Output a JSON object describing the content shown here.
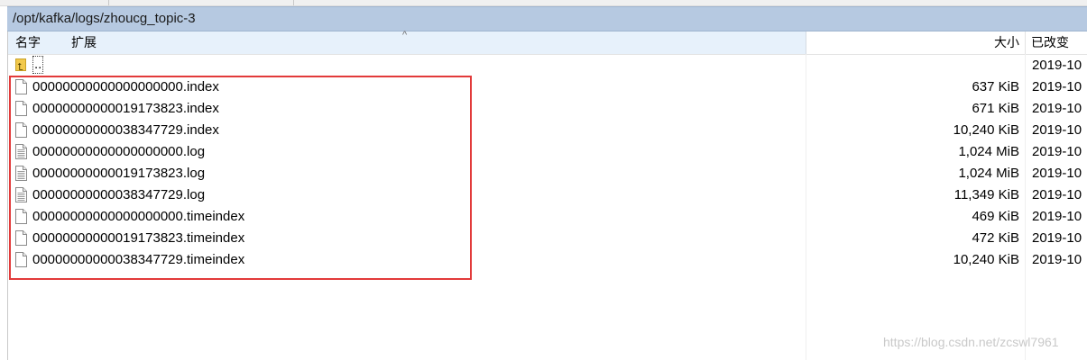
{
  "window": {
    "path": "/opt/kafka/logs/zhoucg_topic-3"
  },
  "columns": {
    "name": "名字",
    "ext": "扩展",
    "sort_indicator": "^",
    "size": "大小",
    "changed": "已改变"
  },
  "parent_entry": {
    "name": "..",
    "date": "2019-10"
  },
  "files": [
    {
      "name": "00000000000000000000.index",
      "size": "637 KiB",
      "date": "2019-10",
      "icon": "blank-file-icon"
    },
    {
      "name": "00000000000019173823.index",
      "size": "671 KiB",
      "date": "2019-10",
      "icon": "blank-file-icon"
    },
    {
      "name": "00000000000038347729.index",
      "size": "10,240 KiB",
      "date": "2019-10",
      "icon": "blank-file-icon"
    },
    {
      "name": "00000000000000000000.log",
      "size": "1,024 MiB",
      "date": "2019-10",
      "icon": "text-file-icon"
    },
    {
      "name": "00000000000019173823.log",
      "size": "1,024 MiB",
      "date": "2019-10",
      "icon": "text-file-icon"
    },
    {
      "name": "00000000000038347729.log",
      "size": "11,349 KiB",
      "date": "2019-10",
      "icon": "text-file-icon"
    },
    {
      "name": "00000000000000000000.timeindex",
      "size": "469 KiB",
      "date": "2019-10",
      "icon": "blank-file-icon"
    },
    {
      "name": "00000000000019173823.timeindex",
      "size": "472 KiB",
      "date": "2019-10",
      "icon": "blank-file-icon"
    },
    {
      "name": "00000000000038347729.timeindex",
      "size": "10,240 KiB",
      "date": "2019-10",
      "icon": "blank-file-icon"
    }
  ],
  "watermark": "https://blog.csdn.net/zcswl7961",
  "colors": {
    "path_bar": "#b6c9e1",
    "header_sorted": "#e7f1fb",
    "highlight_box": "#e23a3a"
  }
}
